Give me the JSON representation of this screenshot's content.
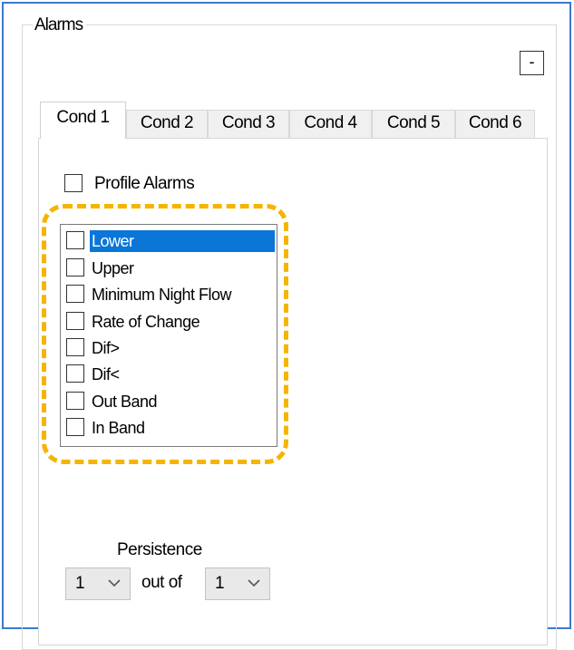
{
  "group": {
    "title": "Alarms",
    "collapse_label": "-"
  },
  "tabs": [
    {
      "label": "Cond 1",
      "active": true
    },
    {
      "label": "Cond 2",
      "active": false
    },
    {
      "label": "Cond 3",
      "active": false
    },
    {
      "label": "Cond 4",
      "active": false
    },
    {
      "label": "Cond 5",
      "active": false
    },
    {
      "label": "Cond 6",
      "active": false
    }
  ],
  "profile_alarms": {
    "label": "Profile Alarms",
    "checked": false
  },
  "alarm_list": {
    "items": [
      {
        "label": "Lower",
        "checked": false,
        "selected": true
      },
      {
        "label": "Upper",
        "checked": false,
        "selected": false
      },
      {
        "label": "Minimum Night Flow",
        "checked": false,
        "selected": false
      },
      {
        "label": "Rate of Change",
        "checked": false,
        "selected": false
      },
      {
        "label": "Dif>",
        "checked": false,
        "selected": false
      },
      {
        "label": "Dif<",
        "checked": false,
        "selected": false
      },
      {
        "label": "Out Band",
        "checked": false,
        "selected": false
      },
      {
        "label": "In Band",
        "checked": false,
        "selected": false
      }
    ]
  },
  "persistence": {
    "label": "Persistence",
    "count_value": "1",
    "out_of_label": "out of",
    "total_value": "1"
  },
  "colors": {
    "selection": "#0a76d8",
    "highlight": "#f5b400",
    "frame": "#3c78d0"
  }
}
